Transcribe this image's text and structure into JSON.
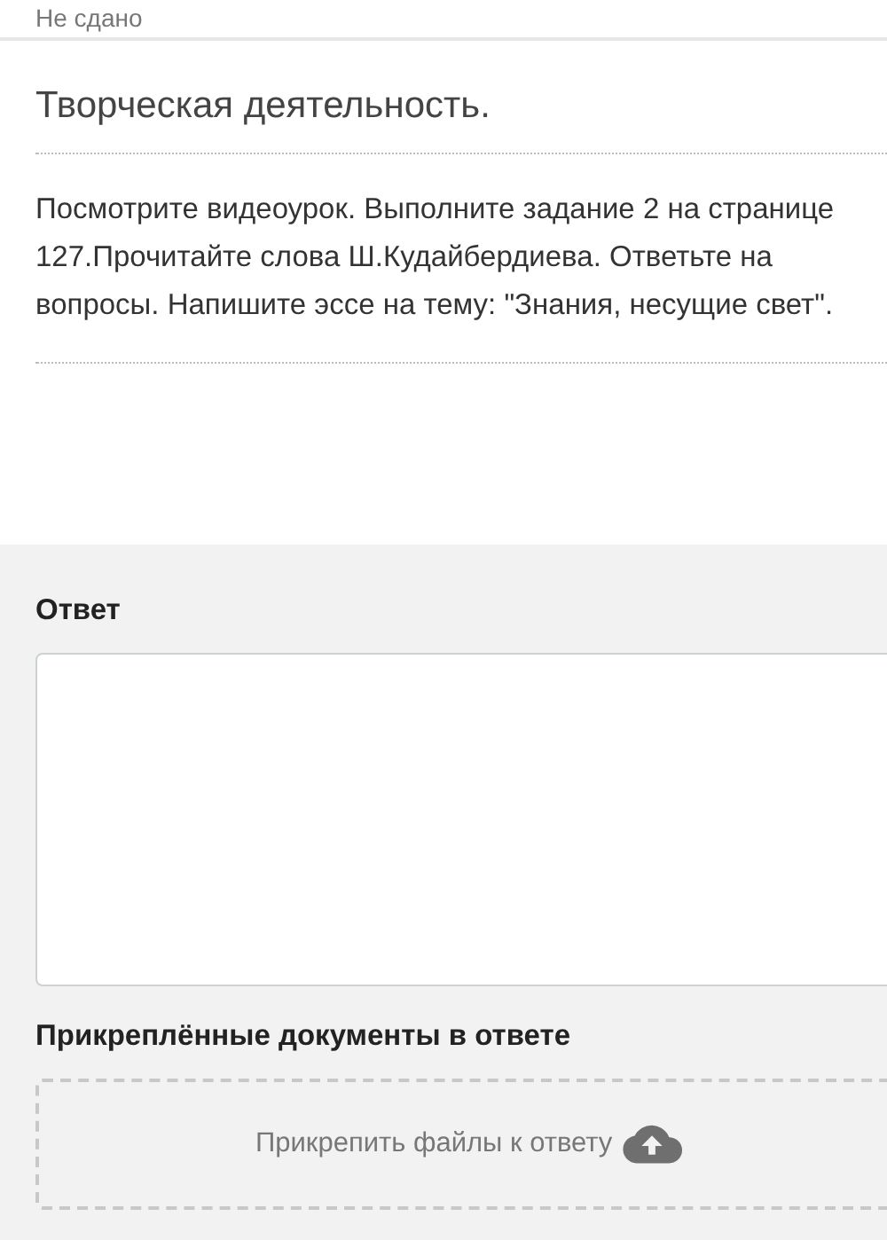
{
  "status": "Не сдано",
  "task": {
    "title": "Творческая деятельность.",
    "text": "Посмотрите видеоурок. Выполните задание 2 на странице 127.Прочитайте слова Ш.Кудайбердиева. Ответьте на вопросы. Напишите  эссе на тему: \"Знания, несущие  свет\"."
  },
  "answer": {
    "label": "Ответ",
    "attachments_label": "Прикреплённые документы в ответе",
    "attach_button": "Прикрепить файлы к ответу"
  }
}
